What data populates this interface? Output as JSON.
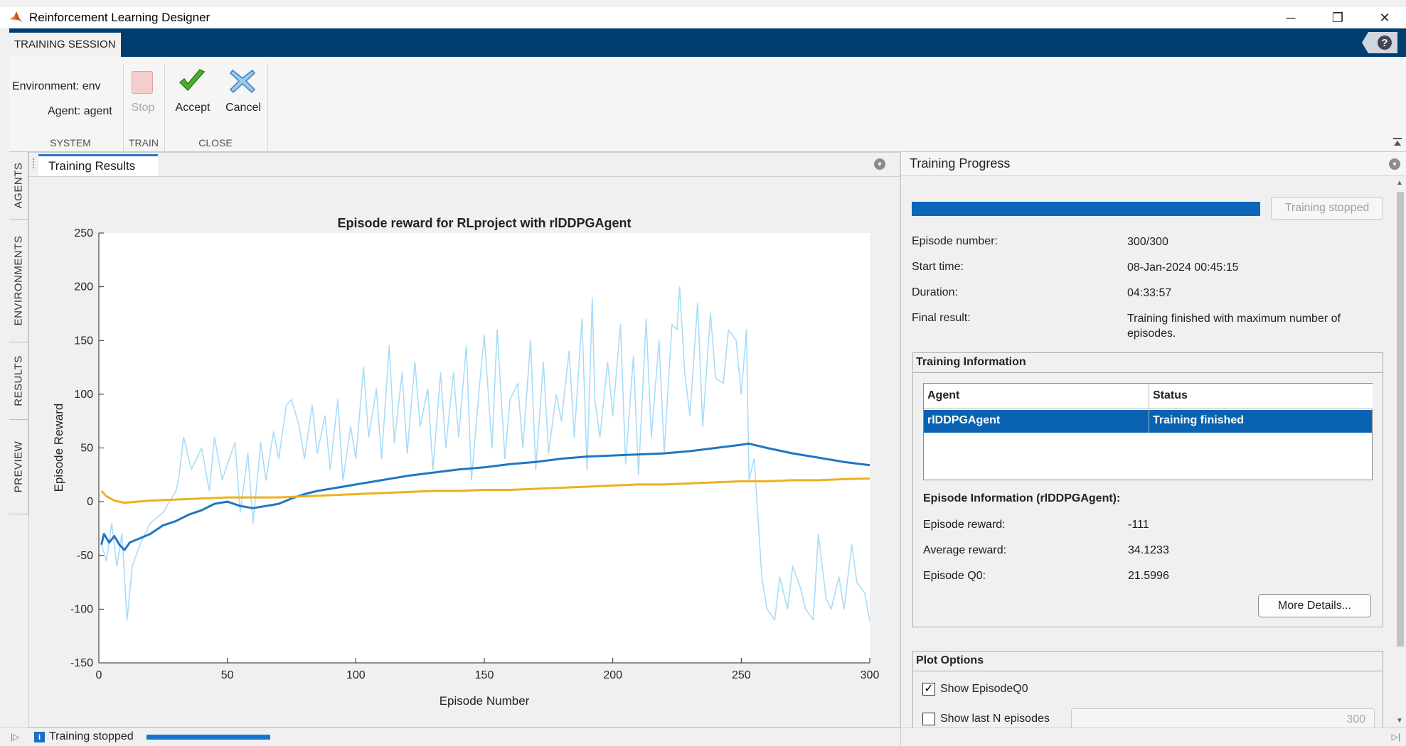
{
  "window": {
    "title": "Reinforcement Learning Designer",
    "minimize": "─",
    "restore": "❐",
    "close": "✕"
  },
  "ribbon": {
    "tab": "TRAINING SESSION",
    "help": "?"
  },
  "toolstrip": {
    "environment_label": "Environment: env",
    "agent_label": "Agent: agent",
    "stop_label": "Stop",
    "accept_label": "Accept",
    "cancel_label": "Cancel",
    "sections": {
      "system": "SYSTEM",
      "train": "TRAIN",
      "close": "CLOSE"
    }
  },
  "side_tabs": [
    "AGENTS",
    "ENVIRONMENTS",
    "RESULTS",
    "PREVIEW"
  ],
  "results_panel": {
    "tab": "Training Results"
  },
  "progress_panel": {
    "title": "Training Progress",
    "progress_fraction": 1.0,
    "status_button": "Training stopped",
    "fields": [
      {
        "key": "Episode number:",
        "value": "300/300"
      },
      {
        "key": "Start time:",
        "value": "08-Jan-2024 00:45:15"
      },
      {
        "key": "Duration:",
        "value": "04:33:57"
      },
      {
        "key": "Final result:",
        "value": "Training finished with maximum number of episodes."
      }
    ],
    "training_info": {
      "title": "Training Information",
      "columns": [
        "Agent",
        "Status"
      ],
      "rows": [
        {
          "agent": "rlDDPGAgent",
          "status": "Training finished"
        }
      ]
    },
    "episode_info": {
      "title": "Episode Information (rlDDPGAgent):",
      "fields": [
        {
          "key": "Episode reward:",
          "value": "-111"
        },
        {
          "key": "Average reward:",
          "value": "34.1233"
        },
        {
          "key": "Episode Q0:",
          "value": "21.5996"
        }
      ],
      "more_details": "More Details..."
    },
    "plot_options": {
      "title": "Plot Options",
      "show_q0_label": "Show EpisodeQ0",
      "show_q0_checked": true,
      "show_last_n_label": "Show last N episodes",
      "show_last_n_checked": false,
      "last_n_value": "300"
    }
  },
  "status_bar": {
    "text": "Training stopped"
  },
  "colors": {
    "episode_reward": "#a9dcf8",
    "average_reward": "#1f77c1",
    "episode_q0": "#edb120"
  },
  "chart_data": {
    "type": "line",
    "title": "Episode reward for RLproject with rlDDPGAgent",
    "xlabel": "Episode Number",
    "ylabel": "Episode Reward",
    "xlim": [
      0,
      300
    ],
    "ylim": [
      -150,
      250
    ],
    "xticks": [
      0,
      50,
      100,
      150,
      200,
      250,
      300
    ],
    "yticks": [
      -150,
      -100,
      -50,
      0,
      50,
      100,
      150,
      200,
      250
    ],
    "grid": false,
    "series": [
      {
        "key": "episode_reward",
        "x": [
          1,
          3,
          5,
          7,
          9,
          11,
          13,
          16,
          20,
          25,
          30,
          31,
          33,
          36,
          40,
          43,
          45,
          48,
          50,
          53,
          55,
          58,
          60,
          63,
          65,
          68,
          70,
          73,
          75,
          78,
          80,
          83,
          85,
          88,
          90,
          93,
          95,
          98,
          100,
          103,
          105,
          108,
          110,
          113,
          115,
          118,
          120,
          123,
          125,
          128,
          130,
          133,
          135,
          138,
          140,
          143,
          145,
          148,
          150,
          153,
          155,
          158,
          160,
          163,
          165,
          168,
          170,
          173,
          175,
          178,
          180,
          183,
          185,
          188,
          190,
          192,
          193,
          195,
          198,
          200,
          203,
          205,
          208,
          210,
          213,
          215,
          218,
          220,
          223,
          225,
          226,
          228,
          230,
          233,
          235,
          238,
          240,
          243,
          245,
          248,
          250,
          252,
          253,
          255,
          258,
          260,
          263,
          265,
          268,
          270,
          273,
          275,
          278,
          280,
          283,
          285,
          288,
          290,
          293,
          295,
          298,
          300
        ],
        "y": [
          -40,
          -55,
          -20,
          -60,
          -30,
          -110,
          -60,
          -40,
          -20,
          -10,
          10,
          20,
          60,
          30,
          50,
          10,
          60,
          20,
          35,
          55,
          -10,
          45,
          -20,
          55,
          20,
          65,
          40,
          90,
          95,
          70,
          40,
          90,
          45,
          80,
          30,
          95,
          20,
          70,
          40,
          125,
          60,
          105,
          40,
          145,
          55,
          120,
          45,
          130,
          70,
          105,
          30,
          120,
          50,
          120,
          60,
          145,
          20,
          105,
          155,
          50,
          160,
          40,
          95,
          110,
          50,
          150,
          30,
          130,
          45,
          100,
          75,
          140,
          60,
          170,
          30,
          190,
          95,
          60,
          130,
          80,
          165,
          35,
          135,
          25,
          170,
          60,
          150,
          45,
          165,
          160,
          200,
          120,
          80,
          185,
          70,
          175,
          115,
          110,
          160,
          150,
          100,
          160,
          20,
          40,
          -70,
          -100,
          -110,
          -70,
          -100,
          -60,
          -80,
          -100,
          -110,
          -30,
          -90,
          -100,
          -70,
          -100,
          -40,
          -75,
          -85,
          -111
        ]
      },
      {
        "key": "average_reward",
        "x": [
          1,
          2,
          4,
          6,
          8,
          10,
          12,
          15,
          20,
          25,
          30,
          35,
          40,
          45,
          50,
          55,
          60,
          65,
          70,
          75,
          80,
          85,
          90,
          95,
          100,
          110,
          120,
          130,
          140,
          150,
          160,
          170,
          180,
          190,
          200,
          210,
          220,
          230,
          240,
          250,
          253,
          260,
          270,
          280,
          290,
          300
        ],
        "y": [
          -40,
          -30,
          -38,
          -32,
          -40,
          -45,
          -38,
          -35,
          -30,
          -22,
          -18,
          -12,
          -8,
          -2,
          0,
          -4,
          -6,
          -4,
          -2,
          3,
          7,
          10,
          12,
          14,
          16,
          20,
          24,
          27,
          30,
          32,
          35,
          37,
          40,
          42,
          43,
          44,
          45,
          47,
          50,
          53,
          54,
          50,
          45,
          41,
          37,
          34
        ]
      },
      {
        "key": "episode_q0",
        "x": [
          1,
          3,
          6,
          10,
          15,
          20,
          30,
          40,
          50,
          60,
          70,
          80,
          90,
          100,
          110,
          120,
          130,
          140,
          150,
          160,
          170,
          180,
          190,
          200,
          210,
          220,
          230,
          240,
          250,
          260,
          270,
          280,
          290,
          300
        ],
        "y": [
          10,
          5,
          1,
          -1,
          0,
          1,
          2,
          3,
          4,
          4,
          4,
          5,
          6,
          7,
          8,
          9,
          10,
          10,
          11,
          11,
          12,
          13,
          14,
          15,
          16,
          16,
          17,
          18,
          19,
          19,
          20,
          20,
          21,
          21.6
        ]
      }
    ]
  }
}
